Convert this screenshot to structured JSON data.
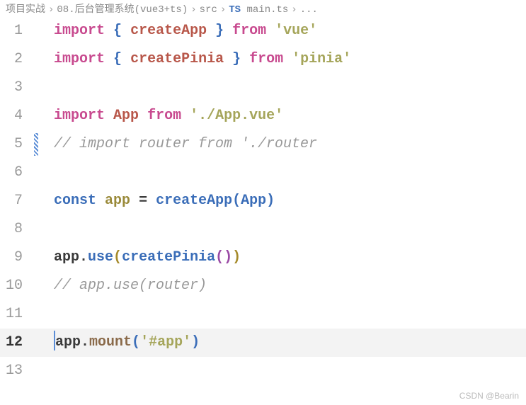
{
  "breadcrumb": {
    "p1": "项目实战",
    "p2": "08.后台管理系统(vue3+ts)",
    "p3": "src",
    "p4": "TS",
    "p5": "main.ts",
    "p6": "...",
    "sep": "›"
  },
  "code": {
    "l1": {
      "kw": "import",
      "brace_o": "{",
      "id": "createApp",
      "brace_c": "}",
      "from": "from",
      "str": "'vue'"
    },
    "l2": {
      "kw": "import",
      "brace_o": "{",
      "id": "createPinia",
      "brace_c": "}",
      "from": "from",
      "str": "'pinia'"
    },
    "l4": {
      "kw": "import",
      "id": "App",
      "from": "from",
      "str": "'./App.vue'"
    },
    "l5": {
      "comment": "// import router from './router"
    },
    "l7": {
      "const": "const",
      "name": "app",
      "eq": "=",
      "call": "createApp",
      "po": "(",
      "arg": "App",
      "pc": ")"
    },
    "l9": {
      "obj": "app",
      "dot": ".",
      "prop": "use",
      "po": "(",
      "call": "createPinia",
      "po2": "(",
      "pc2": ")",
      "pc": ")"
    },
    "l10": {
      "comment": "// app.use(router)"
    },
    "l12": {
      "obj": "app",
      "dot": ".",
      "prop": "mount",
      "po": "(",
      "str": "'#app'",
      "pc": ")"
    }
  },
  "lineNumbers": {
    "n1": "1",
    "n2": "2",
    "n3": "3",
    "n4": "4",
    "n5": "5",
    "n6": "6",
    "n7": "7",
    "n8": "8",
    "n9": "9",
    "n10": "10",
    "n11": "11",
    "n12": "12",
    "n13": "13"
  },
  "watermark": "CSDN @Bearin"
}
